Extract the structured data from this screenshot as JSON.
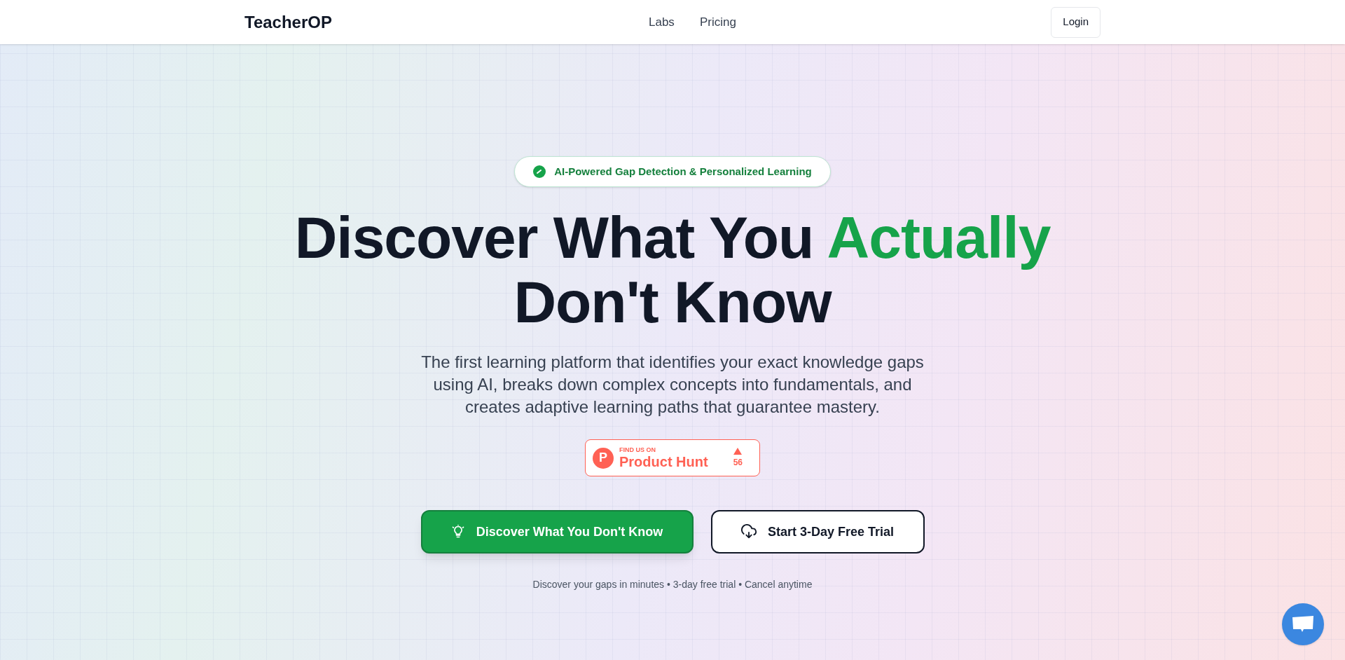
{
  "nav": {
    "logo": "TeacherOP",
    "links": [
      "Labs",
      "Pricing"
    ],
    "login": "Login"
  },
  "badge": {
    "text": "AI-Powered Gap Detection & Personalized Learning"
  },
  "heading": {
    "lines": [
      [
        {
          "text": "Discover What You ",
          "accent": false
        },
        {
          "text": "Actually",
          "accent": true
        }
      ],
      [
        {
          "text": "Don't Know",
          "accent": false
        }
      ]
    ]
  },
  "subtitle": "The first learning platform that identifies your exact knowledge gaps using AI, breaks down complex concepts into fundamentals, and creates adaptive learning paths that guarantee mastery.",
  "product_hunt": {
    "kicker": "FIND US ON",
    "name": "Product Hunt",
    "votes": "56",
    "logo_letter": "P"
  },
  "buttons": [
    {
      "label": "Discover What You Don't Know",
      "kind": "primary"
    },
    {
      "label": "Start 3-Day Free Trial",
      "kind": "secondary"
    }
  ],
  "note": "Discover your gaps in minutes • 3-day free trial • Cancel anytime"
}
